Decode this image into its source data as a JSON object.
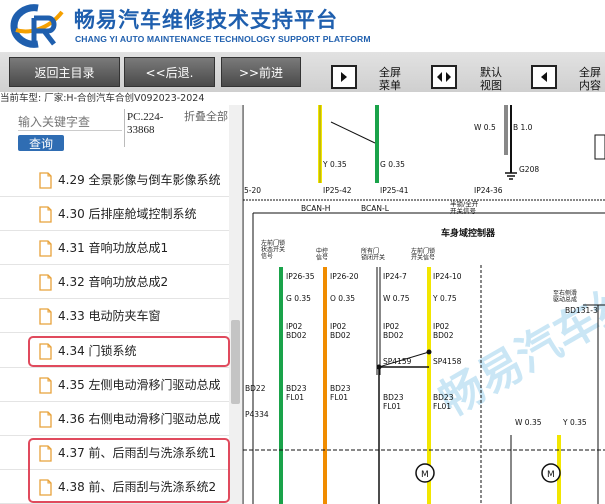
{
  "header": {
    "title_cn": "畅易汽车维修技术支持平台",
    "title_en": "CHANG YI AUTO MAINTENANCE TECHNOLOGY SUPPORT PLATFORM",
    "logo_letters": "CR",
    "brand_color": "#1f5fae"
  },
  "toolbar": {
    "back_main_label": "返回主目录",
    "back_label": "<<后退.",
    "forward_label": ">>前进",
    "fullscreen_menu_label": "全屏\n菜单",
    "default_view_label": "默认\n视图",
    "fullscreen_content_label": "全屏\n内容"
  },
  "status": {
    "text": "当前车型:   厂家:H-合创汽车合创V092023-2024"
  },
  "sidebar": {
    "search_placeholder": "输入关键字查",
    "search_button": "查询",
    "model_code": "PC.224-33868",
    "collapse_all": "折叠全部",
    "items": [
      {
        "label": "4.29 全景影像与倒车影像系统",
        "highlighted": false
      },
      {
        "label": "4.30 后排座舱域控制系统",
        "highlighted": false
      },
      {
        "label": "4.31 音响功放总成1",
        "highlighted": false
      },
      {
        "label": "4.32 音响功放总成2",
        "highlighted": false
      },
      {
        "label": "4.33 电动防夹车窗",
        "highlighted": false
      },
      {
        "label": "4.34 门锁系统",
        "highlighted": true
      },
      {
        "label": "4.35 左侧电动滑移门驱动总成",
        "highlighted": false
      },
      {
        "label": "4.36 右侧电动滑移门驱动总成",
        "highlighted": false
      },
      {
        "label": "4.37 前、后雨刮与洗涤系统1",
        "highlighted": true
      },
      {
        "label": "4.38 前、后雨刮与洗涤系统2",
        "highlighted": true
      }
    ],
    "highlight_color": "#e04a5d"
  },
  "diagram": {
    "watermark": "畅易汽车维",
    "labels": {
      "y035_top": "Y 0.35",
      "g035_top": "G 0.35",
      "w05_top": "W 0.5",
      "b10": "B 1.0",
      "ip2542": "IP25-42",
      "ip2541": "IP25-41",
      "ip2436": "IP24-36",
      "ref520": "5-20",
      "g208": "G208",
      "bcan_h": "BCAN-H",
      "bcan_l": "BCAN-L",
      "half_switch": "半锁/全开\n开关信号",
      "bcm_title": "车身域控制器",
      "left_door_sw": "左前门锁\n状态开关\n信号",
      "center_lock": "中控\n信号",
      "all_doors": "所有门\n锁闭开关",
      "left_door_open": "左前门锁\n开关信号",
      "ip2635": "IP26-35",
      "ip2620": "IP26-20",
      "ip247": "IP24-7",
      "ip2410": "IP24-10",
      "g035": "G 0.35",
      "o035": "O 0.35",
      "w075": "W 0.75",
      "y075": "Y 0.75",
      "ip02_23": "IP02",
      "bd02": "BD02",
      "sp4159": "SP4159",
      "sp4158": "SP4158",
      "bd22": "BD22",
      "bd23": "BD23",
      "fl01": "FL01",
      "rear_door_lock": "至右侧滑\n驱动总成",
      "bd131": "BD131-3",
      "p4334": "P4334",
      "w035": "W 0.35",
      "y035": "Y 0.35",
      "motor": "M"
    },
    "wire_colors": {
      "yellow": "#f2e600",
      "green": "#1aa34a",
      "orange": "#f08c00",
      "white": "#ffffff",
      "black": "#111111"
    }
  }
}
